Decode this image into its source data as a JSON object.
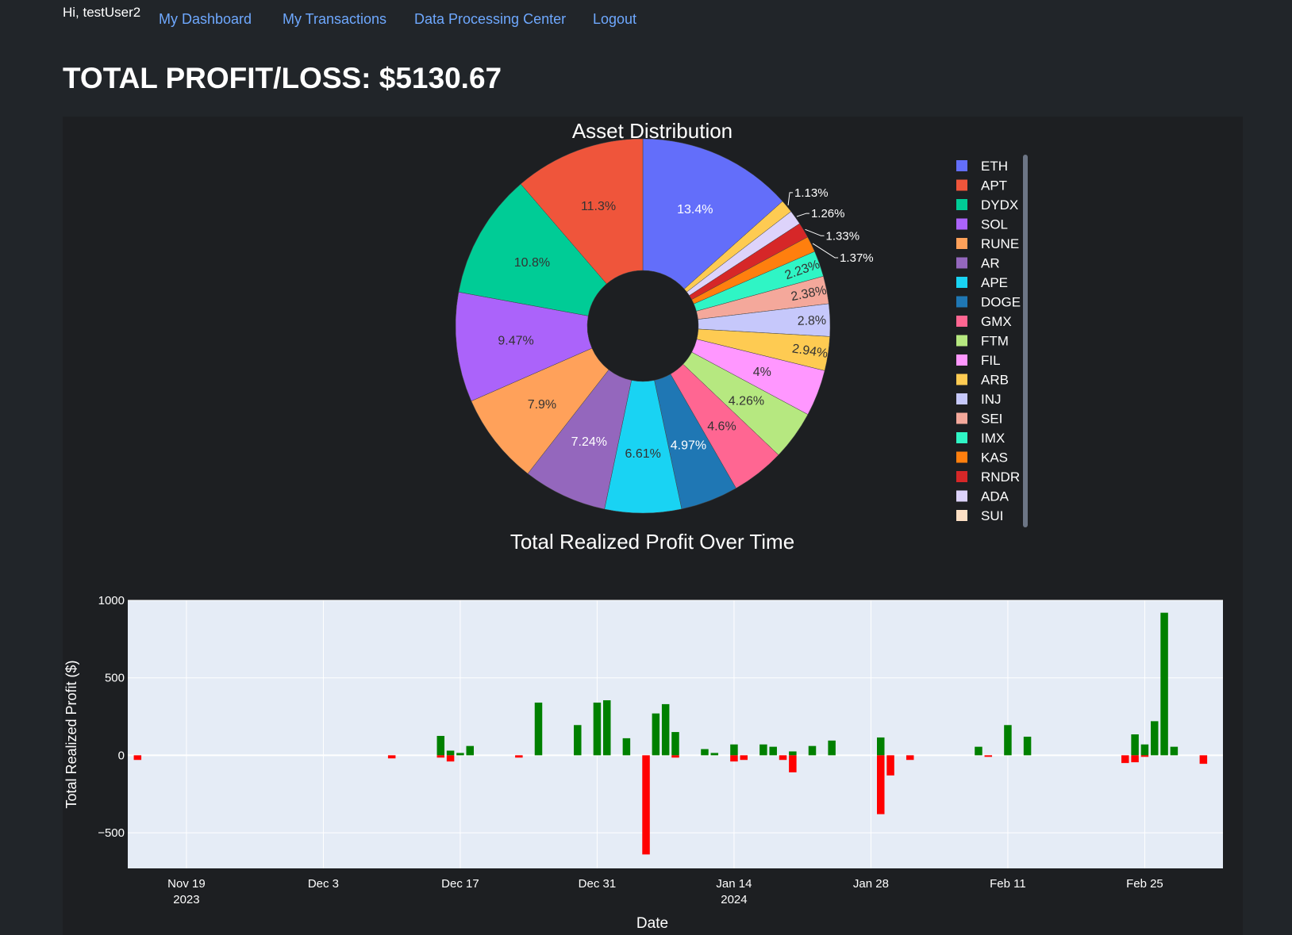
{
  "nav": {
    "greeting": "Hi, testUser2",
    "links": [
      "My Dashboard",
      "My Transactions",
      "Data Processing Center",
      "Logout"
    ],
    "link_color": "#6ea8fe"
  },
  "page_title": "TOTAL PROFIT/LOSS: $5130.67",
  "chart_data": [
    {
      "type": "pie",
      "title": "Asset Distribution",
      "hole": true,
      "legend_position": "right",
      "labels": [
        "ETH",
        "SUI",
        "ADA",
        "RNDR",
        "KAS",
        "IMX",
        "SEI",
        "INJ",
        "ARB",
        "FIL",
        "FTM",
        "GMX",
        "DOGE",
        "APE",
        "AR",
        "RUNE",
        "SOL",
        "DYDX",
        "APT"
      ],
      "values": [
        13.4,
        1.13,
        1.26,
        1.33,
        1.37,
        2.23,
        2.38,
        2.8,
        2.94,
        4,
        4.26,
        4.6,
        4.97,
        6.61,
        7.24,
        7.9,
        9.47,
        10.8,
        11.3
      ],
      "value_labels": [
        "13.4%",
        "1.13%",
        "1.26%",
        "1.33%",
        "1.37%",
        "2.23%",
        "2.38%",
        "2.8%",
        "2.94%",
        "4%",
        "4.26%",
        "4.6%",
        "4.97%",
        "6.61%",
        "7.24%",
        "7.9%",
        "9.47%",
        "10.8%",
        "11.3%"
      ],
      "colors": [
        "#636efa",
        "#fecb52",
        "#ddd3fb",
        "#d62728",
        "#ff7f0e",
        "#2ff5c5",
        "#f4a89b",
        "#c6c8fb",
        "#fecb52",
        "#ff97ff",
        "#b6e880",
        "#ff6692",
        "#1f77b4",
        "#19d3f3",
        "#9467bd",
        "#ffa15a",
        "#ab63fa",
        "#00cc96",
        "#ef553b"
      ],
      "legend": [
        {
          "label": "ETH",
          "color": "#636efa"
        },
        {
          "label": "APT",
          "color": "#ef553b"
        },
        {
          "label": "DYDX",
          "color": "#00cc96"
        },
        {
          "label": "SOL",
          "color": "#ab63fa"
        },
        {
          "label": "RUNE",
          "color": "#ffa15a"
        },
        {
          "label": "AR",
          "color": "#9467bd"
        },
        {
          "label": "APE",
          "color": "#19d3f3"
        },
        {
          "label": "DOGE",
          "color": "#1f77b4"
        },
        {
          "label": "GMX",
          "color": "#ff6692"
        },
        {
          "label": "FTM",
          "color": "#b6e880"
        },
        {
          "label": "FIL",
          "color": "#ff97ff"
        },
        {
          "label": "ARB",
          "color": "#fecb52"
        },
        {
          "label": "INJ",
          "color": "#c6c8fb"
        },
        {
          "label": "SEI",
          "color": "#f4a89b"
        },
        {
          "label": "IMX",
          "color": "#2ff5c5"
        },
        {
          "label": "KAS",
          "color": "#ff7f0e"
        },
        {
          "label": "RNDR",
          "color": "#d62728"
        },
        {
          "label": "ADA",
          "color": "#ddd3fb"
        },
        {
          "label": "SUI",
          "color": "#fde0c5"
        }
      ]
    },
    {
      "type": "bar",
      "title": "Total Realized Profit Over Time",
      "xlabel": "Date",
      "ylabel": "Total Realized Profit ($)",
      "ylim": [
        -730,
        1000
      ],
      "yticks": [
        -500,
        0,
        500,
        1000
      ],
      "ytick_labels": [
        "−500",
        "0",
        "500",
        "1000"
      ],
      "xlim": [
        "2023-11-13",
        "2024-03-04"
      ],
      "xticks": [
        {
          "date": "2023-11-19",
          "line1": "Nov 19",
          "line2": "2023"
        },
        {
          "date": "2023-12-03",
          "line1": "Dec 3",
          "line2": ""
        },
        {
          "date": "2023-12-17",
          "line1": "Dec 17",
          "line2": ""
        },
        {
          "date": "2023-12-31",
          "line1": "Dec 31",
          "line2": ""
        },
        {
          "date": "2024-01-14",
          "line1": "Jan 14",
          "line2": "2024"
        },
        {
          "date": "2024-01-28",
          "line1": "Jan 28",
          "line2": ""
        },
        {
          "date": "2024-02-11",
          "line1": "Feb 11",
          "line2": ""
        },
        {
          "date": "2024-02-25",
          "line1": "Feb 25",
          "line2": ""
        }
      ],
      "positive_color": "#008000",
      "negative_color": "#ff0000",
      "bars": [
        {
          "date": "2023-11-14",
          "value": -30
        },
        {
          "date": "2023-12-10",
          "value": -20
        },
        {
          "date": "2023-12-15",
          "value": 125
        },
        {
          "date": "2023-12-15",
          "value": -15
        },
        {
          "date": "2023-12-16",
          "value": 30
        },
        {
          "date": "2023-12-16",
          "value": -40
        },
        {
          "date": "2023-12-17",
          "value": 15
        },
        {
          "date": "2023-12-18",
          "value": 60
        },
        {
          "date": "2023-12-23",
          "value": -15
        },
        {
          "date": "2023-12-25",
          "value": 340
        },
        {
          "date": "2023-12-29",
          "value": 195
        },
        {
          "date": "2023-12-31",
          "value": 340
        },
        {
          "date": "2024-01-01",
          "value": 355
        },
        {
          "date": "2024-01-03",
          "value": 110
        },
        {
          "date": "2024-01-05",
          "value": -640
        },
        {
          "date": "2024-01-06",
          "value": 270
        },
        {
          "date": "2024-01-07",
          "value": 330
        },
        {
          "date": "2024-01-08",
          "value": 150
        },
        {
          "date": "2024-01-08",
          "value": -15
        },
        {
          "date": "2024-01-11",
          "value": 40
        },
        {
          "date": "2024-01-12",
          "value": 15
        },
        {
          "date": "2024-01-14",
          "value": 70
        },
        {
          "date": "2024-01-14",
          "value": -40
        },
        {
          "date": "2024-01-15",
          "value": -30
        },
        {
          "date": "2024-01-17",
          "value": 70
        },
        {
          "date": "2024-01-18",
          "value": 55
        },
        {
          "date": "2024-01-19",
          "value": -30
        },
        {
          "date": "2024-01-20",
          "value": 25
        },
        {
          "date": "2024-01-20",
          "value": -110
        },
        {
          "date": "2024-01-22",
          "value": 60
        },
        {
          "date": "2024-01-24",
          "value": 95
        },
        {
          "date": "2024-01-29",
          "value": 115
        },
        {
          "date": "2024-01-29",
          "value": -380
        },
        {
          "date": "2024-01-30",
          "value": -130
        },
        {
          "date": "2024-02-01",
          "value": -30
        },
        {
          "date": "2024-02-08",
          "value": 55
        },
        {
          "date": "2024-02-09",
          "value": -10
        },
        {
          "date": "2024-02-11",
          "value": 195
        },
        {
          "date": "2024-02-13",
          "value": 120
        },
        {
          "date": "2024-02-23",
          "value": -50
        },
        {
          "date": "2024-02-24",
          "value": 135
        },
        {
          "date": "2024-02-24",
          "value": -45
        },
        {
          "date": "2024-02-25",
          "value": 70
        },
        {
          "date": "2024-02-25",
          "value": -10
        },
        {
          "date": "2024-02-26",
          "value": 220
        },
        {
          "date": "2024-02-27",
          "value": 920
        },
        {
          "date": "2024-02-28",
          "value": 55
        },
        {
          "date": "2024-03-02",
          "value": -55
        }
      ]
    }
  ]
}
